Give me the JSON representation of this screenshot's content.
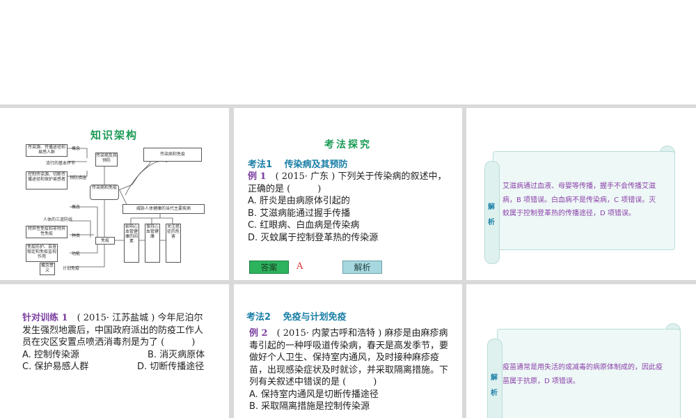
{
  "mindmap": {
    "title": "知识架构",
    "nodes": {
      "n1": "传染源、传播途径和易感人群",
      "n2": "传染病及其预防",
      "n3": "传染病和免疫",
      "n4": "控制传染源、切断传播途径和保护易感者",
      "n5": "传染病和免疫",
      "n6": "威胁人体健康的当代主要疾病",
      "n7": "特异性免疫和非特异性免疫",
      "n8": "免疫",
      "n9": "免疫防护、自身稳定和免疫监视作用",
      "n10": "影响心血管健康的因素",
      "n11": "保持心血管健康",
      "n12": "关注癌症的危害",
      "n13": "概念意义"
    },
    "labels": {
      "l1": "概念",
      "l2": "流行的基本环节",
      "l3": "预防措施",
      "l4": "概念",
      "l5": "人体的三道防线",
      "l6": "种类",
      "l7": "功能",
      "l8": "计划免疫"
    }
  },
  "section1": {
    "title": "考法探究",
    "kaofa": "考法1　 传染病及其预防",
    "example_label": "例 1",
    "example_text": "　( 2015· 广东 ) 下列关于传染病的叙述中，正确的是 (　　　)",
    "options": [
      "A. 肝炎是由病原体引起的",
      "B. 艾滋病能通过握手传播",
      "C. 红眼病、白血病是传染病",
      "D. 灭蚊属于控制登革热的传染源"
    ],
    "answer_btn": "答案",
    "answer": "A",
    "explain_btn": "解析"
  },
  "explain1": {
    "tag": "解析",
    "text": "艾滋病通过血液、母婴等传播，握手不会传播艾滋病，B 项错误。白血病不是传染病，C 项错误。灭蚊属于控制登革热的传播途径，D 项错误。"
  },
  "practice": {
    "label": "针对训练 1",
    "text": "　( 2015· 江苏盐城 ) 今年尼泊尔发生强烈地震后，中国政府派出的防疫工作人员在灾区安置点喷洒消毒剂是为了 (　　　)",
    "opt_a": "A. 控制传染源",
    "opt_b": "B. 消灭病原体",
    "opt_c": "C. 保护易感人群",
    "opt_d": "D. 切断传播途径"
  },
  "section2": {
    "kaofa": "考法2　 免疫与计划免疫",
    "example_label": "例 2",
    "example_text": "　( 2015· 内蒙古呼和浩特 ) 麻疹是由麻疹病毒引起的一种呼吸道传染病，春天是高发季节，要做好个人卫生、保持室内通风，及时接种麻疹疫苗，出现感染症状及时就诊，并采取隔离措施。下列有关叙述中错误的是 (　　　)",
    "opt_a": "A. 保持室内通风是切断传播途径",
    "opt_b": "B. 采取隔离措施是控制传染源"
  },
  "explain2": {
    "tag": "解析",
    "text": "疫苗通常是用失活的或减毒的病原体制成的，因此疫苗属于抗原，D 项错误。"
  }
}
